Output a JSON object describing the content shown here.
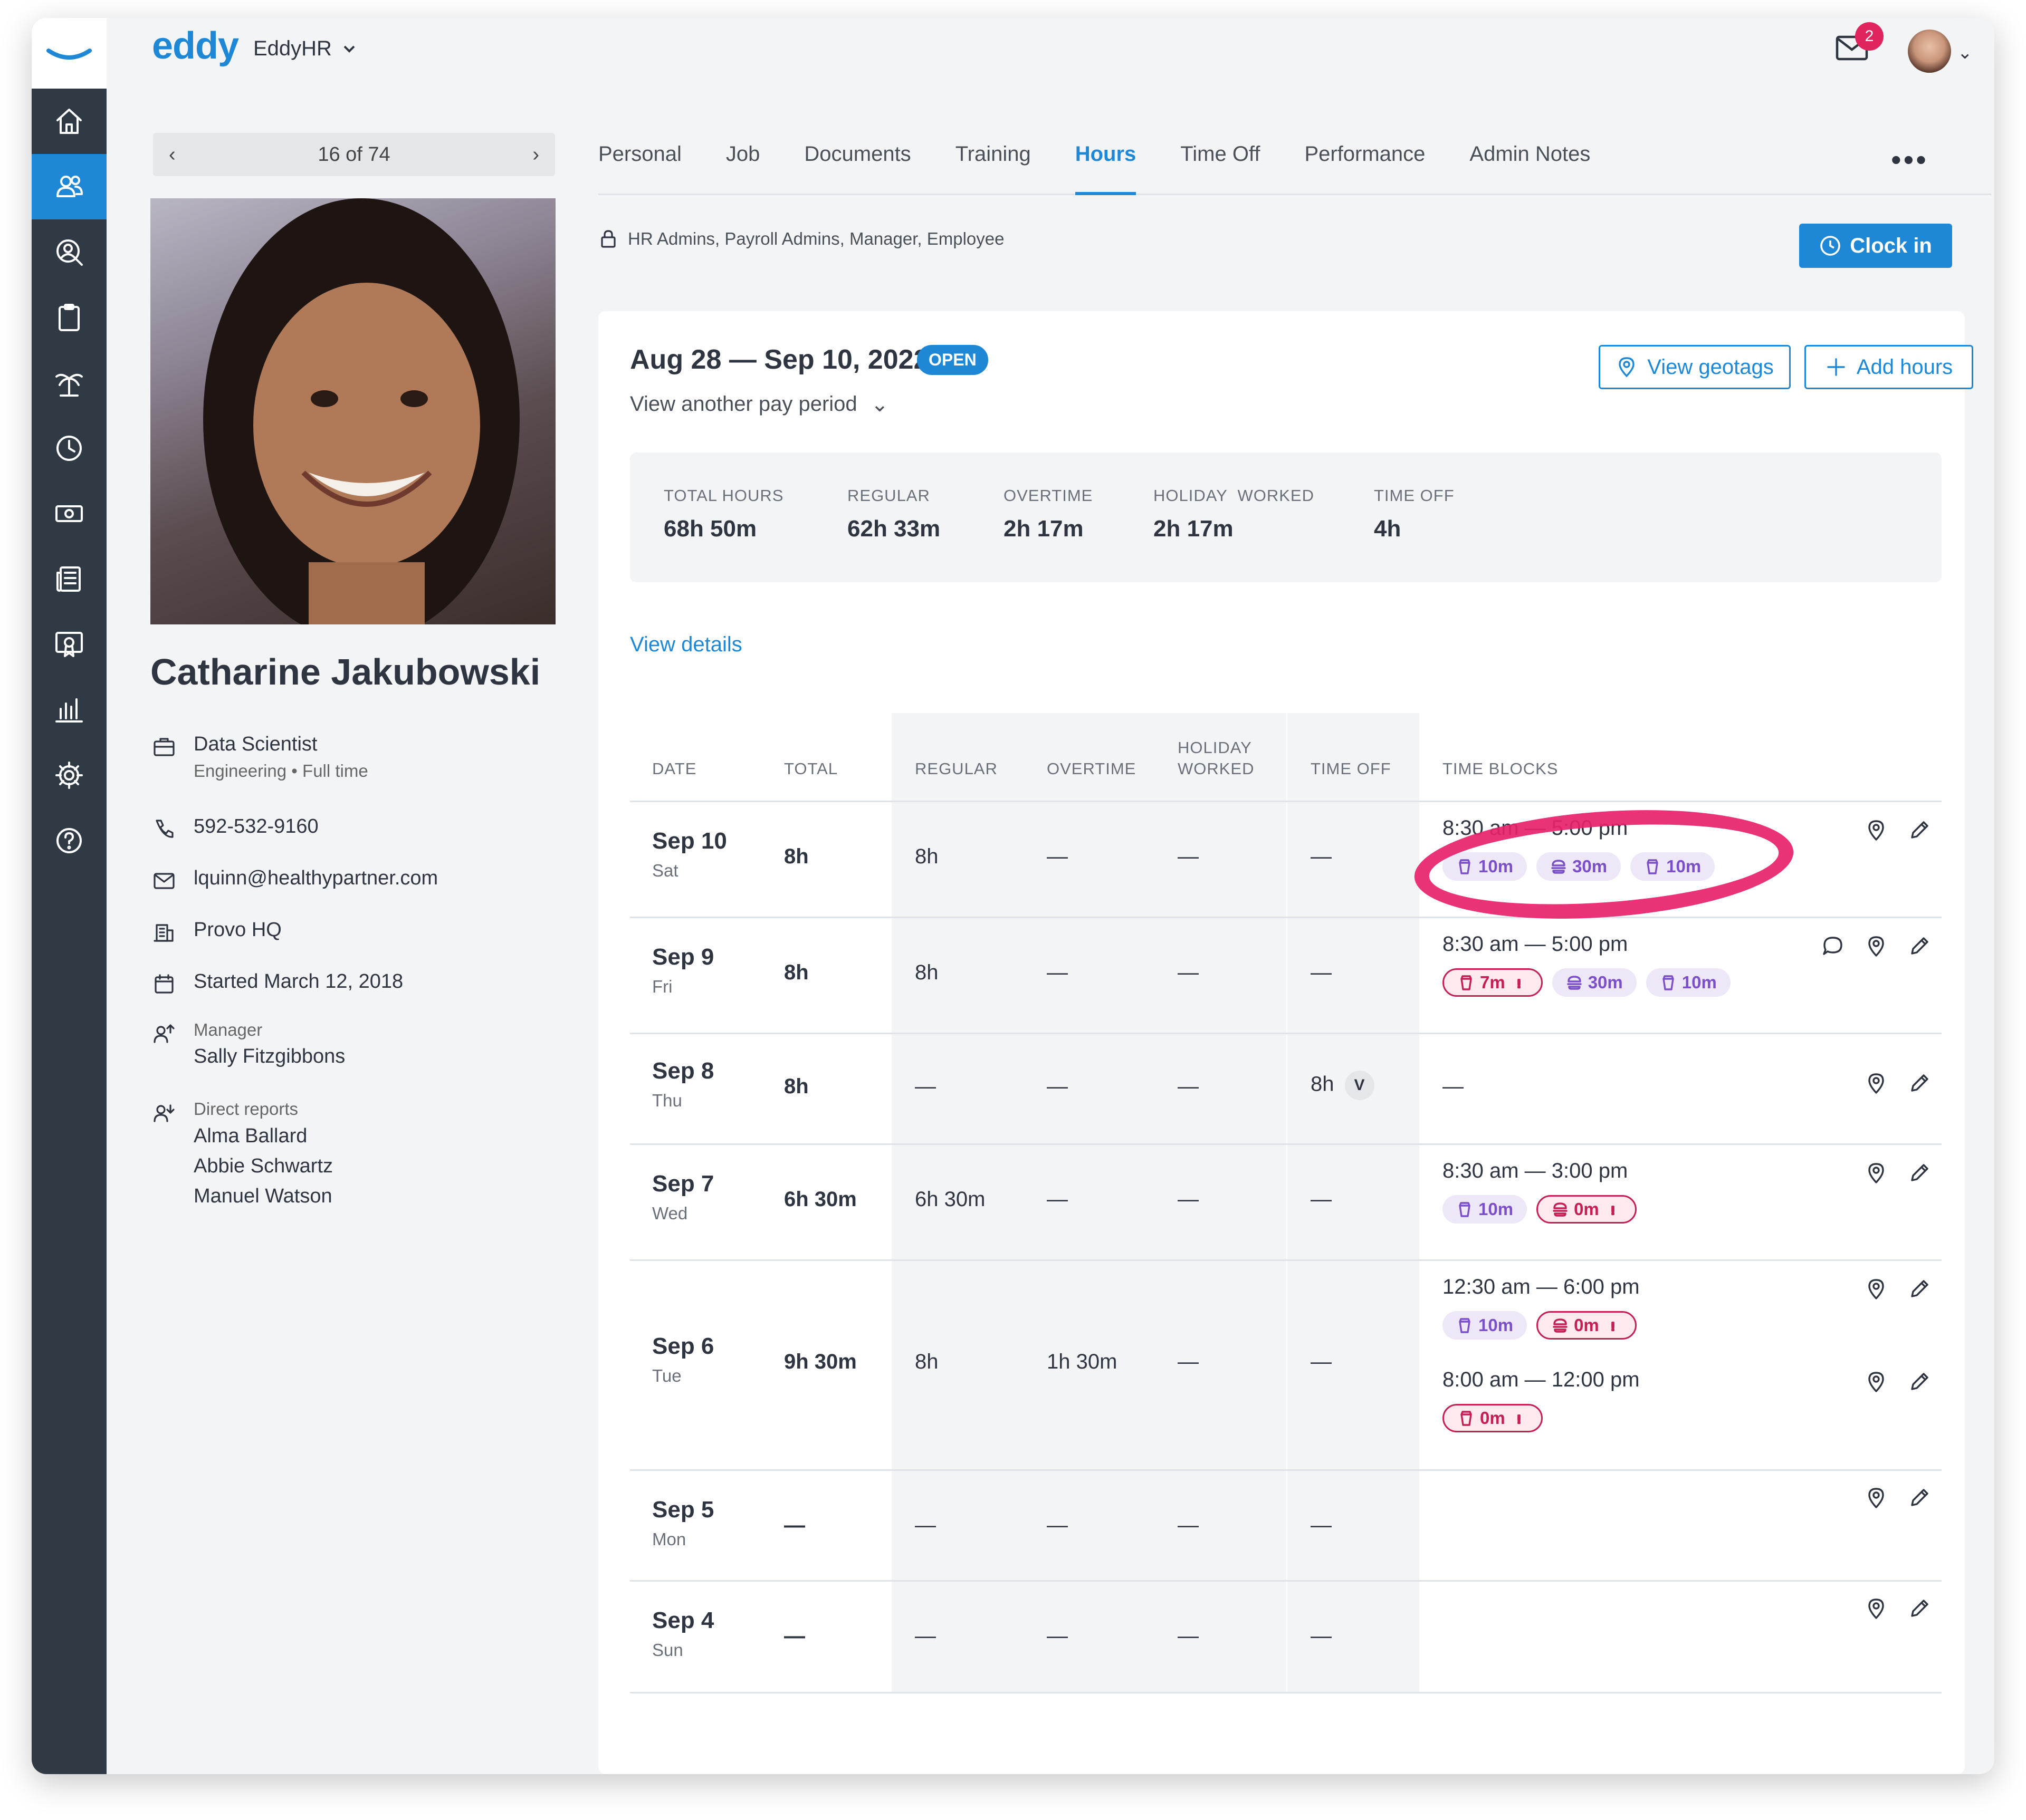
{
  "topbar": {
    "logo": "eddy",
    "company": "EddyHR",
    "mail_count": "2"
  },
  "sidebar": {
    "items": [
      "home-icon",
      "people-icon",
      "person-search-icon",
      "clipboard-icon",
      "palm-tree-icon",
      "clock-icon",
      "money-icon",
      "newspaper-icon",
      "certificate-icon",
      "bar-chart-icon",
      "gear-icon",
      "help-icon"
    ],
    "active": 1
  },
  "pager": {
    "label": "16 of 74"
  },
  "employee": {
    "name": "Catharine Jakubowski",
    "title": "Data Scientist",
    "department": "Engineering",
    "employment": "Full time",
    "phone": "592-532-9160",
    "email": "lquinn@healthypartner.com",
    "location": "Provo HQ",
    "started": "Started March 12, 2018",
    "manager_label": "Manager",
    "manager": "Sally Fitzgibbons",
    "reports_label": "Direct reports",
    "reports": [
      "Alma Ballard",
      "Abbie Schwartz",
      "Manuel Watson"
    ]
  },
  "tabs": [
    "Personal",
    "Job",
    "Documents",
    "Training",
    "Hours",
    "Time Off",
    "Performance",
    "Admin Notes"
  ],
  "active_tab": "Hours",
  "permissions": "HR Admins, Payroll Admins,  Manager, Employee",
  "clock_in": "Clock in",
  "period": {
    "range": "Aug 28 — Sep 10, 2022",
    "status": "OPEN",
    "another": "View another pay period",
    "geotags": "View geotags",
    "add": "Add hours",
    "details": "View details"
  },
  "stats": [
    {
      "label": "TOTAL HOURS",
      "value": "68h 50m"
    },
    {
      "label": "REGULAR",
      "value": "62h 33m"
    },
    {
      "label": "OVERTIME",
      "value": "2h 17m"
    },
    {
      "label": "HOLIDAY  WORKED",
      "value": "2h 17m"
    },
    {
      "label": "TIME OFF",
      "value": "4h"
    }
  ],
  "table": {
    "headers": {
      "date": "DATE",
      "total": "TOTAL",
      "regular": "REGULAR",
      "overtime": "OVERTIME",
      "holiday_1": "HOLIDAY",
      "holiday_2": "WORKED",
      "timeoff": "TIME OFF",
      "blocks": "TIME BLOCKS"
    },
    "rows": [
      {
        "date": "Sep 10",
        "dow": "Sat",
        "total": "8h",
        "regular": "8h",
        "overtime": "—",
        "holiday": "—",
        "timeoff": "—",
        "blocks": [
          {
            "time": "8:30 am — 5:00 pm",
            "chips": [
              {
                "icon": "cup-icon",
                "text": "10m",
                "warn": false
              },
              {
                "icon": "burger-icon",
                "text": "30m",
                "warn": false
              },
              {
                "icon": "cup-icon",
                "text": "10m",
                "warn": false
              }
            ]
          }
        ]
      },
      {
        "date": "Sep 9",
        "dow": "Fri",
        "total": "8h",
        "regular": "8h",
        "overtime": "—",
        "holiday": "—",
        "timeoff": "—",
        "blocks": [
          {
            "time": "8:30 am — 5:00 pm",
            "chips": [
              {
                "icon": "cup-icon",
                "text": "7m",
                "warn": true
              },
              {
                "icon": "burger-icon",
                "text": "30m",
                "warn": false
              },
              {
                "icon": "cup-icon",
                "text": "10m",
                "warn": false
              }
            ]
          }
        ]
      },
      {
        "date": "Sep 8",
        "dow": "Thu",
        "total": "8h",
        "regular": "—",
        "overtime": "—",
        "holiday": "—",
        "timeoff": "8h",
        "timeoff_badge": "V",
        "blocks_empty": "—"
      },
      {
        "date": "Sep 7",
        "dow": "Wed",
        "total": "6h 30m",
        "regular": "6h 30m",
        "overtime": "—",
        "holiday": "—",
        "timeoff": "—",
        "blocks": [
          {
            "time": "8:30 am — 3:00 pm",
            "chips": [
              {
                "icon": "cup-icon",
                "text": "10m",
                "warn": false
              },
              {
                "icon": "burger-icon",
                "text": "0m",
                "warn": true
              }
            ]
          }
        ]
      },
      {
        "date": "Sep 6",
        "dow": "Tue",
        "total": "9h 30m",
        "regular": "8h",
        "overtime": "1h 30m",
        "holiday": "—",
        "timeoff": "—",
        "blocks": [
          {
            "time": "12:30 am — 6:00 pm",
            "chips": [
              {
                "icon": "cup-icon",
                "text": "10m",
                "warn": false
              },
              {
                "icon": "burger-icon",
                "text": "0m",
                "warn": true
              }
            ]
          },
          {
            "time": "8:00 am — 12:00 pm",
            "chips": [
              {
                "icon": "cup-icon",
                "text": "0m",
                "warn": true
              }
            ]
          }
        ]
      },
      {
        "date": "Sep 5",
        "dow": "Mon",
        "total": "—",
        "regular": "—",
        "overtime": "—",
        "holiday": "—",
        "timeoff": "—"
      },
      {
        "date": "Sep 4",
        "dow": "Sun",
        "total": "—",
        "regular": "—",
        "overtime": "—",
        "holiday": "—",
        "timeoff": "—"
      }
    ]
  },
  "colors": {
    "accent": "#1e88d6",
    "sidebar": "#2f3a44",
    "highlight": "#e8226a",
    "warning": "#c41e52",
    "chip": "#7a4fc8"
  }
}
